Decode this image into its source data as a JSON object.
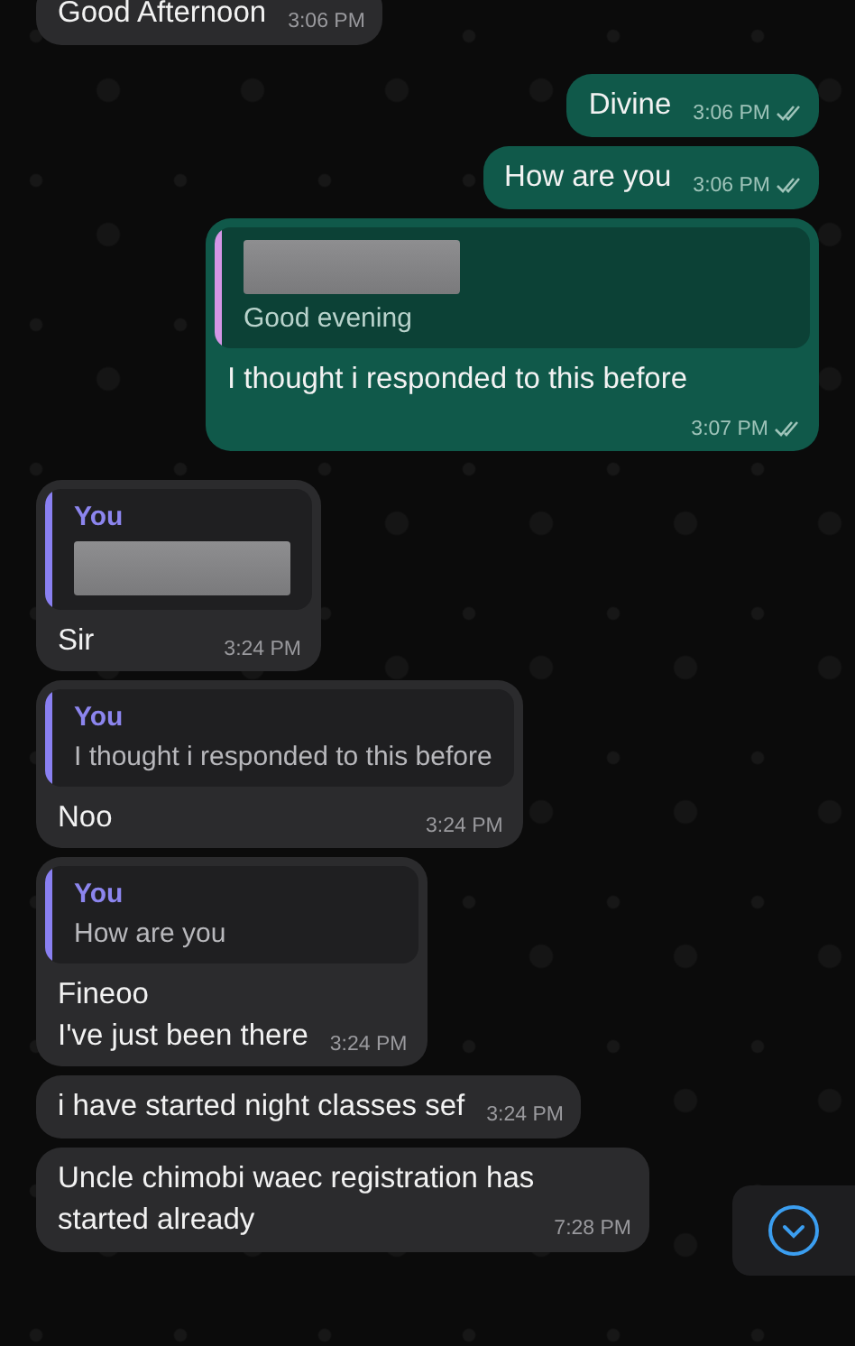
{
  "messages": [
    {
      "kind": "received",
      "text": "Good Afternoon",
      "time": "3:06 PM"
    },
    {
      "kind": "sent",
      "text": "Divine",
      "time": "3:06 PM",
      "read": true
    },
    {
      "kind": "sent",
      "text": "How are you",
      "time": "3:06 PM",
      "read": true
    },
    {
      "kind": "sent",
      "quote": {
        "redacted": true,
        "text": "Good evening"
      },
      "text": "I thought i responded to this before",
      "time": "3:07 PM",
      "read": true
    },
    {
      "kind": "received",
      "quote": {
        "author": "You",
        "redacted": true
      },
      "text": "Sir",
      "time": "3:24 PM"
    },
    {
      "kind": "received",
      "quote": {
        "author": "You",
        "text": "I thought i responded to this before"
      },
      "text": "Noo",
      "time": "3:24 PM"
    },
    {
      "kind": "received",
      "quote": {
        "author": "You",
        "text": "How are you"
      },
      "text": "Fineoo\nI've just been there",
      "time": "3:24 PM"
    },
    {
      "kind": "received",
      "text": "i have started night classes sef",
      "time": "3:24 PM"
    },
    {
      "kind": "received",
      "text": "Uncle chimobi waec registration has started already",
      "time": "7:28 PM"
    }
  ],
  "scroll_button": {
    "visible": true
  }
}
